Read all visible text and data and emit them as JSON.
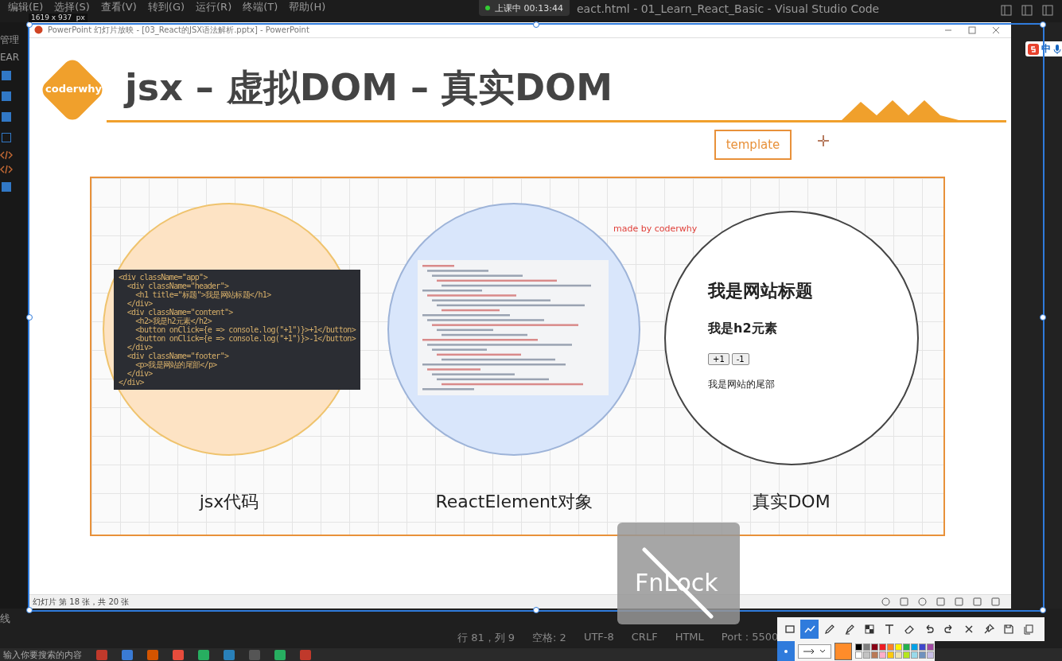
{
  "vscode": {
    "menu": [
      "编辑(E)",
      "选择(S)",
      "查看(V)",
      "转到(G)",
      "运行(R)",
      "终端(T)",
      "帮助(H)"
    ],
    "title": "eact.html - 01_Learn_React_Basic - Visual Studio Code",
    "sidebar_labels": [
      "管理",
      "EAR"
    ],
    "panel_label": "线",
    "status_bar": [
      "行 81，列 9",
      "空格: 2",
      "UTF-8",
      "CRLF",
      "HTML",
      "Port : 5500"
    ]
  },
  "recording_badge": {
    "text": "上课中 00:13:44"
  },
  "ppt": {
    "title": "PowerPoint 幻灯片放映 - [03_React的JSX语法解析.pptx] - PowerPoint",
    "status": "幻灯片 第 18 张，共 20 张"
  },
  "slide": {
    "logo": "coderwhy",
    "title": "jsx – 虚拟DOM – 真实DOM",
    "template_button": "template",
    "credit": "made by coderwhy",
    "code_lines": [
      "<div className=\"app\">",
      "  <div className=\"header\">",
      "    <h1 title=\"标题\">我是网站标题</h1>",
      "  </div>",
      "  <div className=\"content\">",
      "    <h2>我是h2元素</h2>",
      "    <button onClick={e => console.log(\"+1\")}>+1</button>",
      "    <button onClick={e => console.log(\"+1\")}>-1</button>",
      "  </div>",
      "  <div className=\"footer\">",
      "    <p>我是网站的尾部</p>",
      "  </div>",
      "</div>"
    ],
    "dom": {
      "heading": "我是网站标题",
      "subheading": "我是h2元素",
      "buttons": [
        "+1",
        "-1"
      ],
      "footer": "我是网站的尾部"
    },
    "captions": [
      "jsx代码",
      "ReactElement对象",
      "真实DOM"
    ]
  },
  "ime": {
    "label": "中"
  },
  "fnlock": {
    "text": "FnLock"
  },
  "capture": {
    "size": "1619 x 937  px",
    "tools": [
      {
        "kind": "rect",
        "selected": false
      },
      {
        "kind": "line",
        "selected": true
      },
      {
        "kind": "pen",
        "selected": false
      },
      {
        "kind": "marker",
        "selected": false
      },
      {
        "kind": "mosaic",
        "selected": false
      },
      {
        "kind": "text",
        "selected": false
      },
      {
        "kind": "eraser",
        "selected": false
      },
      {
        "kind": "undo",
        "selected": false
      },
      {
        "kind": "redo",
        "selected": false
      },
      {
        "kind": "close",
        "selected": false
      },
      {
        "kind": "pin",
        "selected": false
      },
      {
        "kind": "save",
        "selected": false
      },
      {
        "kind": "copy",
        "selected": false
      }
    ],
    "current_color": {
      "color": "#ff8c2a"
    },
    "swatches": [
      {
        "color": "#000000"
      },
      {
        "color": "#7f7f7f"
      },
      {
        "color": "#880015"
      },
      {
        "color": "#ed1c24"
      },
      {
        "color": "#ff7f27"
      },
      {
        "color": "#fff200"
      },
      {
        "color": "#22b14c"
      },
      {
        "color": "#00a2e8"
      },
      {
        "color": "#3f48cc"
      },
      {
        "color": "#a349a4"
      },
      {
        "color": "#ffffff"
      },
      {
        "color": "#c3c3c3"
      },
      {
        "color": "#b97a57"
      },
      {
        "color": "#ffaec9"
      },
      {
        "color": "#ffc90e"
      },
      {
        "color": "#efe4b0"
      },
      {
        "color": "#b5e61d"
      },
      {
        "color": "#99d9ea"
      },
      {
        "color": "#7092be"
      },
      {
        "color": "#c8bfe7"
      }
    ]
  },
  "taskbar": {
    "search_placeholder": "输入你要搜索的内容"
  }
}
